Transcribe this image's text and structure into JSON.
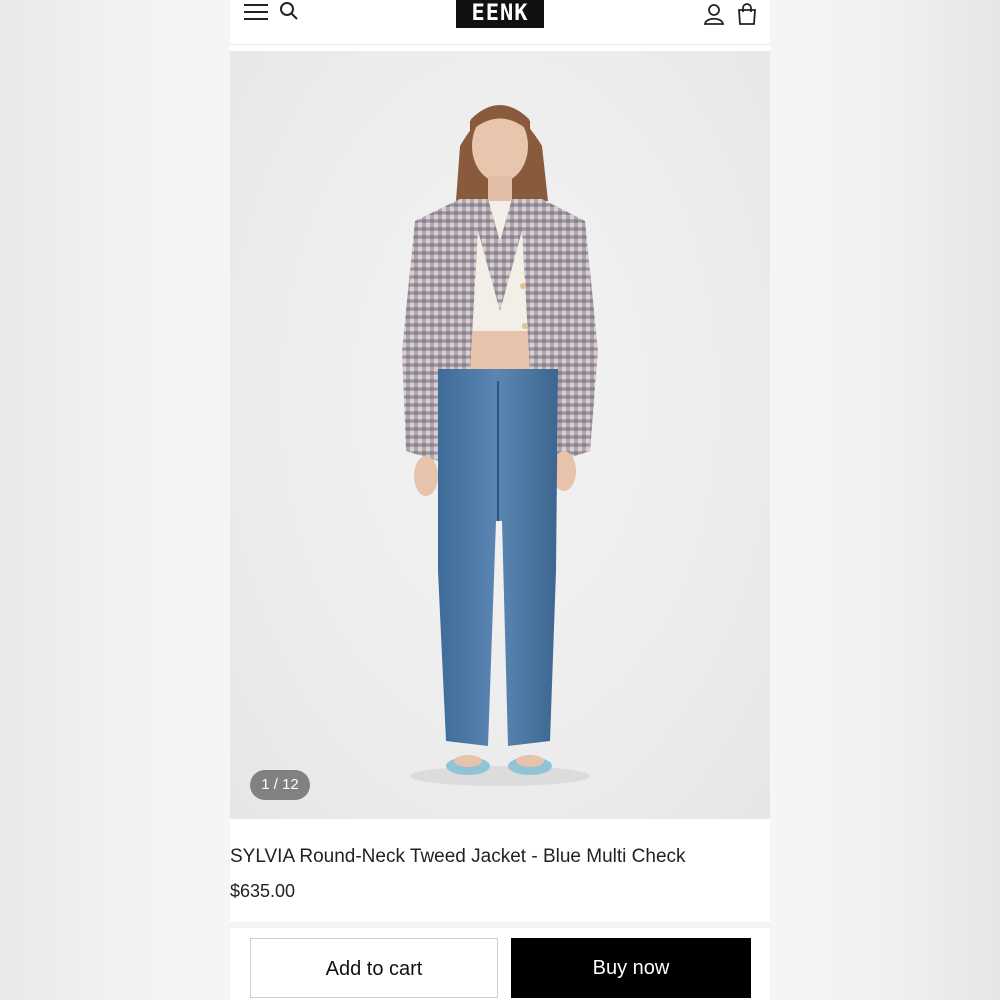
{
  "header": {
    "logo_text": "EENK",
    "menu_icon": "hamburger-menu-icon",
    "search_icon": "search-icon",
    "account_icon": "user-account-icon",
    "bag_icon": "shopping-bag-icon"
  },
  "gallery": {
    "counter": "1 / 12"
  },
  "product": {
    "title": "SYLVIA Round-Neck Tweed Jacket - Blue Multi Check",
    "price": "$635.00"
  },
  "actions": {
    "add_to_cart": "Add to cart",
    "buy_now": "Buy now"
  },
  "colors": {
    "buy_button_bg": "#000000",
    "text": "#222222"
  }
}
